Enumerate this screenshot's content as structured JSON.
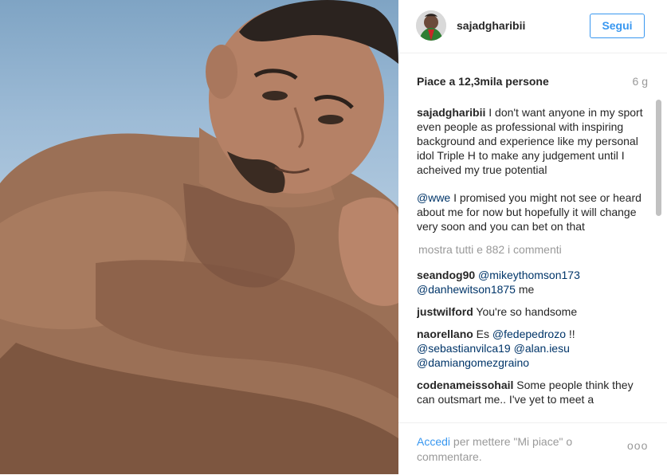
{
  "header": {
    "username": "sajadgharibii",
    "follow_label": "Segui"
  },
  "stats": {
    "likes": "Piace a 12,3mila persone",
    "age": "6 g"
  },
  "caption": {
    "user": "sajadgharibii",
    "text": " I don't want anyone in my sport even people as professional with inspiring background and experience like my personal idol Triple H to make any judgement until I acheived my true potential",
    "mention": "@wwe",
    "text2": " I promised you might not see or heard about me for now but hopefully it will change very soon and you can bet on that"
  },
  "show_all": "mostra tutti e 882 i commenti",
  "comments": [
    {
      "user": "seandog90",
      "m1": "@mikeythomson173",
      "m2": "@danhewitson1875",
      "text": " me"
    },
    {
      "user": "justwilford",
      "text": " You're so handsome"
    },
    {
      "user": "naorellano",
      "pre": " Es ",
      "m1": "@fedepedrozo",
      "post": " !!",
      "m2": "@sebastianvilca19",
      "m3": "@alan.iesu",
      "m4": "@damiangomezgraino"
    },
    {
      "user": "codenameissohail",
      "text": " Some people think they can outsmart me.. I've yet to meet a"
    }
  ],
  "footer": {
    "login": "Accedi",
    "text": " per mettere \"Mi piace\" o commentare.",
    "more": "ooo"
  }
}
